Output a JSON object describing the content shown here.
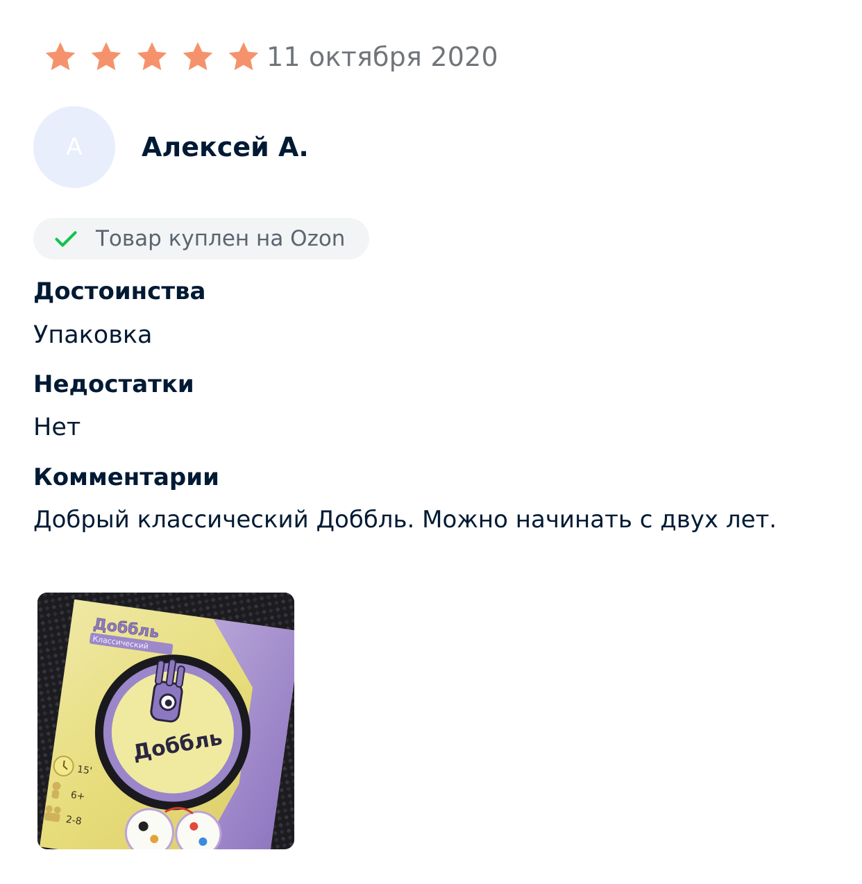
{
  "review": {
    "rating": 5,
    "rating_max": 5,
    "star_color": "#f6926b",
    "date": "11 октября 2020",
    "author": {
      "avatar_letter": "А",
      "name": "Алексей А."
    },
    "verified": {
      "icon": "check-icon",
      "icon_color": "#10c44c",
      "label": "Товар куплен на Ozon"
    },
    "pros": {
      "title": "Достоинства",
      "text": "Упаковка"
    },
    "cons": {
      "title": "Недостатки",
      "text": "Нет"
    },
    "comment": {
      "title": "Комментарии",
      "text": "Добрый классический Доббль. Можно начинать с двух лет."
    },
    "photos": [
      {
        "box_title": "Доббль",
        "box_subtitle": "Классический",
        "box_center_logo": "Доббль",
        "time": "15'",
        "age": "6+",
        "players": "2-8"
      }
    ]
  }
}
